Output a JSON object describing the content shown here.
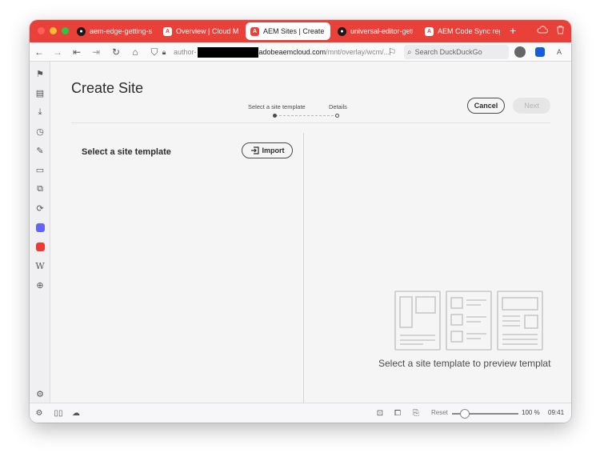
{
  "browser": {
    "tabs": [
      {
        "label": "aem-edge-getting-start",
        "favicon": "github-icon"
      },
      {
        "label": "Overview | Cloud Manag",
        "favicon": "adobe-icon"
      },
      {
        "label": "AEM Sites | Create Site",
        "favicon": "adobe-icon",
        "active": true
      },
      {
        "label": "universal-editor-getting",
        "favicon": "github-icon"
      },
      {
        "label": "AEM Code Sync registra",
        "favicon": "adobe-icon"
      }
    ],
    "url": {
      "prefix": "author-",
      "domain": "adobeaemcloud.com",
      "path": "/mnt/overlay/wcm/..."
    },
    "search_placeholder": "Search DuckDuckGo",
    "accent_color": "#e9413a"
  },
  "page": {
    "title": "Create Site",
    "steps": [
      "Select a site template",
      "Details"
    ],
    "cancel_label": "Cancel",
    "next_label": "Next",
    "left_title": "Select a site template",
    "import_label": "Import",
    "preview_message": "Select a site template to preview templat"
  },
  "status_bar": {
    "reset_label": "Reset",
    "zoom": "100 %",
    "time": "09:41"
  }
}
